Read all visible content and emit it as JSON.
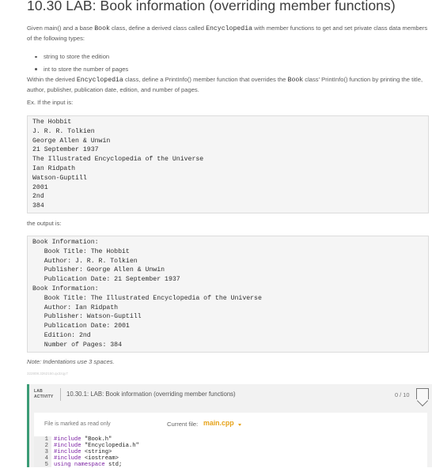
{
  "heading": "10.30 LAB: Book information (overriding member functions)",
  "intro": {
    "part1": "Given main() and a base ",
    "code1": "Book",
    "part2": " class, define a derived class called ",
    "code2": "Encyclopedia",
    "part3": " with member functions to get and set private class data members of the following types:"
  },
  "bullets": [
    "string to store the edition",
    "int to store the number of pages"
  ],
  "within": {
    "part1": "Within the derived ",
    "code1": "Encyclopedia",
    "part2": " class, define a PrintInfo() member function that overrides the ",
    "code2": "Book",
    "part3": " class' PrintInfo() function by printing the title, author, publisher, publication date, edition, and number of pages."
  },
  "example_label": "Ex. If the input is:",
  "input_lines": [
    "The Hobbit",
    "J. R. R. Tolkien",
    "George Allen & Unwin",
    "21 September 1937",
    "The Illustrated Encyclopedia of the Universe",
    "Ian Ridpath",
    "Watson-Guptill",
    "2001",
    "2nd",
    "384"
  ],
  "output_label": "the output is:",
  "output_lines": [
    "Book Information:",
    "   Book Title: The Hobbit",
    "   Author: J. R. R. Tolkien",
    "   Publisher: George Allen & Unwin",
    "   Publication Date: 21 September 1937",
    "Book Information:",
    "   Book Title: The Illustrated Encyclopedia of the Universe",
    "   Author: Ian Ridpath",
    "   Publisher: Watson-Guptill",
    "   Publication Date: 2001",
    "   Edition: 2nd",
    "   Number of Pages: 384"
  ],
  "note": "Note: Indentations use 3 spaces.",
  "tiny_id": "322808.3262150.qx3zqy7",
  "lab": {
    "tag_line1": "LAB",
    "tag_line2": "ACTIVITY",
    "title": "10.30.1: LAB: Book information (overriding member functions)",
    "score": "0 / 10",
    "badge_icon": "ribbon-badge-icon"
  },
  "editor": {
    "readonly_text": "File is marked as read only",
    "current_file_label": "Current file:",
    "current_file_name": "main.cpp",
    "accent_color": "#e6a219",
    "line_numbers": [
      "1",
      "2",
      "3",
      "4",
      "5"
    ],
    "code_lines": [
      "#include \"Book.h\"",
      "#include \"Encyclopedia.h\"",
      "#include <string>",
      "#include <iostream>",
      "using namespace std;"
    ]
  },
  "colors": {
    "lab_accent": "#3b9c76",
    "code_background": "#f5f5f5"
  }
}
